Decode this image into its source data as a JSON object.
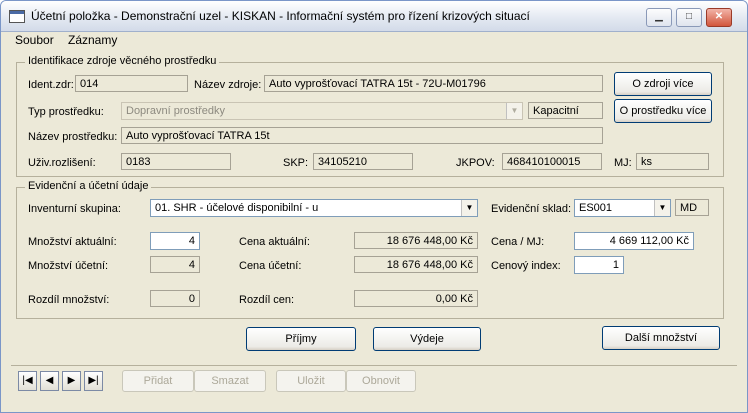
{
  "window": {
    "title": "Účetní položka - Demonstrační uzel - KISKAN - Informační systém pro řízení krizových situací",
    "icon": "window-icon",
    "controls": {
      "minimize": "▁",
      "maximize": "□",
      "close": "✕"
    }
  },
  "menu": [
    "Soubor",
    "Záznamy"
  ],
  "source": {
    "legend": "Identifikace zdroje věcného prostředku",
    "ident_label": "Ident.zdr:",
    "ident_value": "014",
    "name_label": "Název zdroje:",
    "name_value": "Auto vyprošťovací TATRA 15t - 72U-M01796",
    "type_label": "Typ prostředku:",
    "type_value": "Dopravní prostředky",
    "kapacitni": "Kapacitní",
    "prostredek_label": "Název prostředku:",
    "prostredek_value": "Auto vyprošťovací TATRA 15t",
    "uziv_label": "Uživ.rozlišení:",
    "uziv_value": "0183",
    "skp_label": "SKP:",
    "skp_value": "34105210",
    "jkpov_label": "JKPOV:",
    "jkpov_value": "468410100015",
    "mj_label": "MJ:",
    "mj_value": "ks",
    "btn_zdroj": "O zdroji více",
    "btn_prostredek": "O prostředku více"
  },
  "ledger": {
    "legend": "Evidenční a účetní údaje",
    "inv_label": "Inventurní skupina:",
    "inv_value": "01. SHR - účelové disponibilní - u",
    "sklad_label": "Evidenční sklad:",
    "sklad_value": "ES001",
    "sklad_suffix": "MD",
    "mnoz_akt_label": "Množství aktuální:",
    "mnoz_akt_value": "4",
    "mnoz_uc_label": "Množství účetní:",
    "mnoz_uc_value": "4",
    "rozdil_mnoz_label": "Rozdíl množství:",
    "rozdil_mnoz_value": "0",
    "cena_akt_label": "Cena aktuální:",
    "cena_akt_value": "18 676 448,00 Kč",
    "cena_uc_label": "Cena účetní:",
    "cena_uc_value": "18 676 448,00 Kč",
    "rozdil_cen_label": "Rozdíl cen:",
    "rozdil_cen_value": "0,00 Kč",
    "cena_mj_label": "Cena / MJ:",
    "cena_mj_value": "4 669 112,00 Kč",
    "index_label": "Cenový index:",
    "index_value": "1"
  },
  "actions": {
    "prijmy": "Příjmy",
    "vydeje": "Výdeje",
    "dalsi": "Další množství"
  },
  "navigation": {
    "first": "|◀",
    "prev": "◀",
    "next": "▶",
    "last": "▶|"
  },
  "record_buttons": {
    "add": "Přidat",
    "delete": "Smazat",
    "save": "Uložit",
    "refresh": "Obnovit"
  }
}
